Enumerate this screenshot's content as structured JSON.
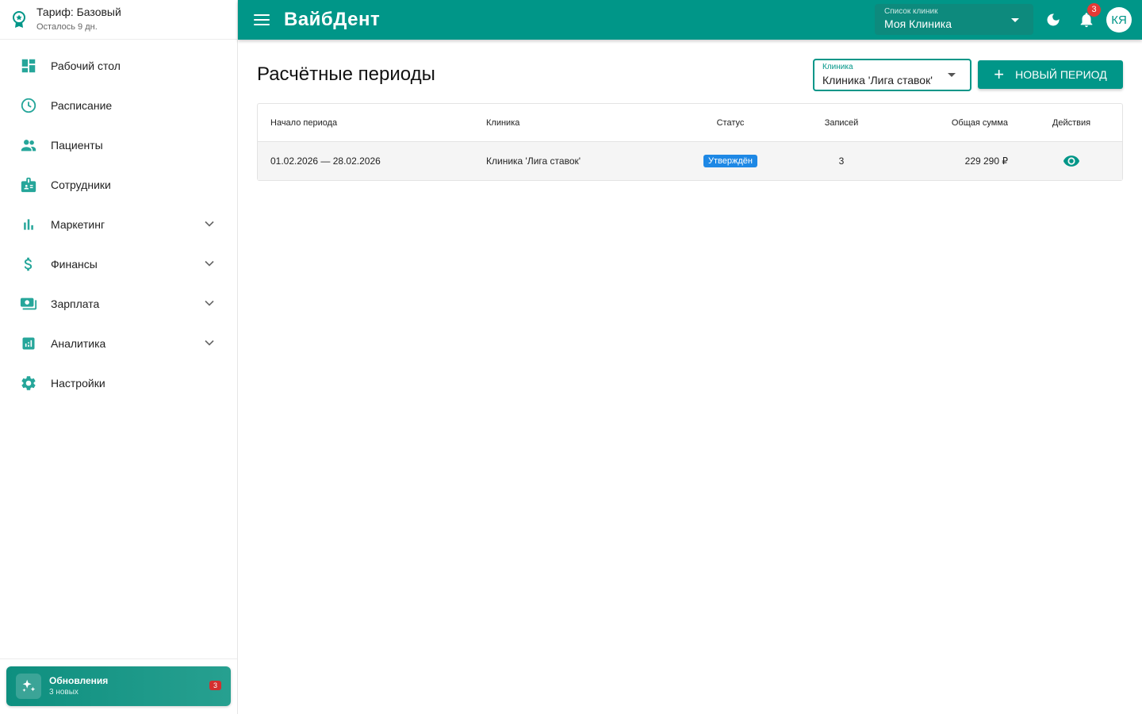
{
  "sidebar": {
    "tariff": {
      "title": "Тариф: Базовый",
      "subtitle": "Осталось 9 дн."
    },
    "items": [
      {
        "label": "Рабочий стол",
        "icon": "dashboard-icon"
      },
      {
        "label": "Расписание",
        "icon": "clock-icon"
      },
      {
        "label": "Пациенты",
        "icon": "people-icon"
      },
      {
        "label": "Сотрудники",
        "icon": "badge-icon"
      },
      {
        "label": "Маркетинг",
        "icon": "bar-chart-icon"
      },
      {
        "label": "Финансы",
        "icon": "dollar-icon"
      },
      {
        "label": "Зарплата",
        "icon": "cash-icon"
      },
      {
        "label": "Аналитика",
        "icon": "analytics-icon"
      },
      {
        "label": "Настройки",
        "icon": "gear-icon"
      }
    ],
    "updates": {
      "title": "Обновления",
      "subtitle": "3 новых",
      "count": "3"
    }
  },
  "topbar": {
    "brand": "ВайбДент",
    "clinic_list": {
      "label": "Список клиник",
      "value": "Моя Клиника"
    },
    "notifications_count": "3",
    "avatar_initials": "КЯ"
  },
  "main": {
    "title": "Расчётные периоды",
    "filter": {
      "label": "Клиника",
      "value": "Клиника 'Лига ставок'"
    },
    "new_button": "НОВЫЙ ПЕРИОД",
    "table": {
      "headers": [
        "Начало периода",
        "Клиника",
        "Статус",
        "Записей",
        "Общая сумма",
        "Действия"
      ],
      "rows": [
        {
          "period": "01.02.2026 — 28.02.2026",
          "clinic": "Клиника 'Лига ставок'",
          "status": "Утверждён",
          "records": "3",
          "total": "229 290 ₽"
        }
      ]
    }
  },
  "colors": {
    "primary": "#009688",
    "status": "#1e88e5",
    "badge": "#e53935"
  }
}
